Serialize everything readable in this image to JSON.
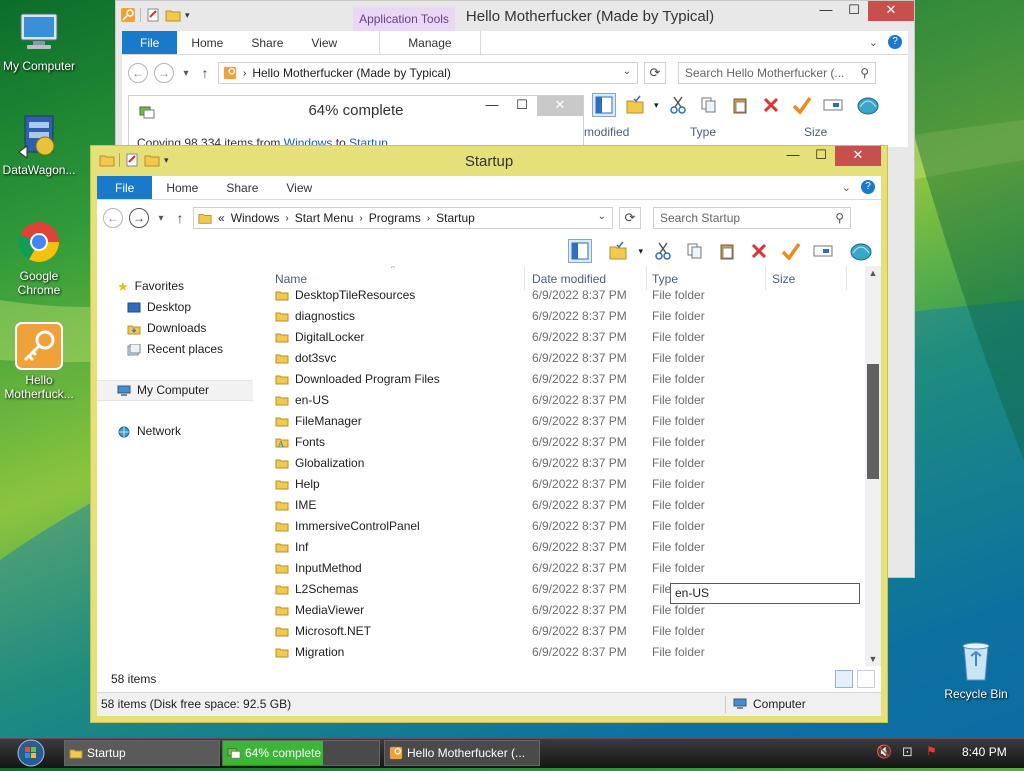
{
  "desktop": {
    "icons": [
      {
        "label": "My Computer"
      },
      {
        "label": "DataWagon..."
      },
      {
        "label": "Google Chrome"
      },
      {
        "label": "Hello Motherfuck..."
      },
      {
        "label": "Recycle Bin"
      }
    ]
  },
  "back_window": {
    "title": "Hello Motherfucker (Made by Typical)",
    "context_tab": "Application Tools",
    "tabs": [
      "File",
      "Home",
      "Share",
      "View",
      "Manage"
    ],
    "address": "Hello Motherfucker (Made by Typical)",
    "search_placeholder": "Search Hello Motherfucker (...",
    "col_modified": "modified",
    "col_type": "Type",
    "col_size": "Size"
  },
  "progress_dialog": {
    "title": "64% complete",
    "line_prefix": "Copying 98,334 items from ",
    "line_from": "Windows",
    "line_mid": " to ",
    "line_to": "Startup"
  },
  "front_window": {
    "title": "Startup",
    "tabs": [
      "File",
      "Home",
      "Share",
      "View"
    ],
    "breadcrumb": {
      "prefix": "«",
      "parts": [
        "Windows",
        "Start Menu",
        "Programs",
        "Startup"
      ],
      "sep": "›"
    },
    "search_placeholder": "Search Startup",
    "nav": {
      "favorites": "Favorites",
      "desktop": "Desktop",
      "downloads": "Downloads",
      "recent": "Recent places",
      "computer": "My Computer",
      "network": "Network"
    },
    "columns": {
      "name": "Name",
      "date": "Date modified",
      "type": "Type",
      "size": "Size"
    },
    "files": [
      {
        "name": "DesktopTileResources",
        "date": "6/9/2022 8:37 PM",
        "type": "File folder"
      },
      {
        "name": "diagnostics",
        "date": "6/9/2022 8:37 PM",
        "type": "File folder"
      },
      {
        "name": "DigitalLocker",
        "date": "6/9/2022 8:37 PM",
        "type": "File folder"
      },
      {
        "name": "dot3svc",
        "date": "6/9/2022 8:37 PM",
        "type": "File folder"
      },
      {
        "name": "Downloaded Program Files",
        "date": "6/9/2022 8:37 PM",
        "type": "File folder"
      },
      {
        "name": "en-US",
        "date": "6/9/2022 8:37 PM",
        "type": "File folder"
      },
      {
        "name": "FileManager",
        "date": "6/9/2022 8:37 PM",
        "type": "File folder"
      },
      {
        "name": "Fonts",
        "date": "6/9/2022 8:37 PM",
        "type": "File folder"
      },
      {
        "name": "Globalization",
        "date": "6/9/2022 8:37 PM",
        "type": "File folder"
      },
      {
        "name": "Help",
        "date": "6/9/2022 8:37 PM",
        "type": "File folder"
      },
      {
        "name": "IME",
        "date": "6/9/2022 8:37 PM",
        "type": "File folder"
      },
      {
        "name": "ImmersiveControlPanel",
        "date": "6/9/2022 8:37 PM",
        "type": "File folder"
      },
      {
        "name": "Inf",
        "date": "6/9/2022 8:37 PM",
        "type": "File folder"
      },
      {
        "name": "InputMethod",
        "date": "6/9/2022 8:37 PM",
        "type": "File folder"
      },
      {
        "name": "L2Schemas",
        "date": "6/9/2022 8:37 PM",
        "type": "File folder"
      },
      {
        "name": "MediaViewer",
        "date": "6/9/2022 8:37 PM",
        "type": "File folder"
      },
      {
        "name": "Microsoft.NET",
        "date": "6/9/2022 8:37 PM",
        "type": "File folder"
      },
      {
        "name": "Migration",
        "date": "6/9/2022 8:37 PM",
        "type": "File folder"
      }
    ],
    "rename_value": "en-US",
    "item_count": "58 items",
    "status_detail": "58 items (Disk free space: 92.5 GB)",
    "status_location": "Computer"
  },
  "taskbar": {
    "buttons": [
      {
        "label": "Startup"
      },
      {
        "label": "64% complete"
      },
      {
        "label": "Hello Motherfucker (..."
      }
    ],
    "clock": "8:40 PM"
  },
  "colors": {
    "front_frame": "#e6e07a",
    "file_tab": "#1979ca",
    "close_button": "#c7504c",
    "context_tab": "#e9d7f3"
  }
}
